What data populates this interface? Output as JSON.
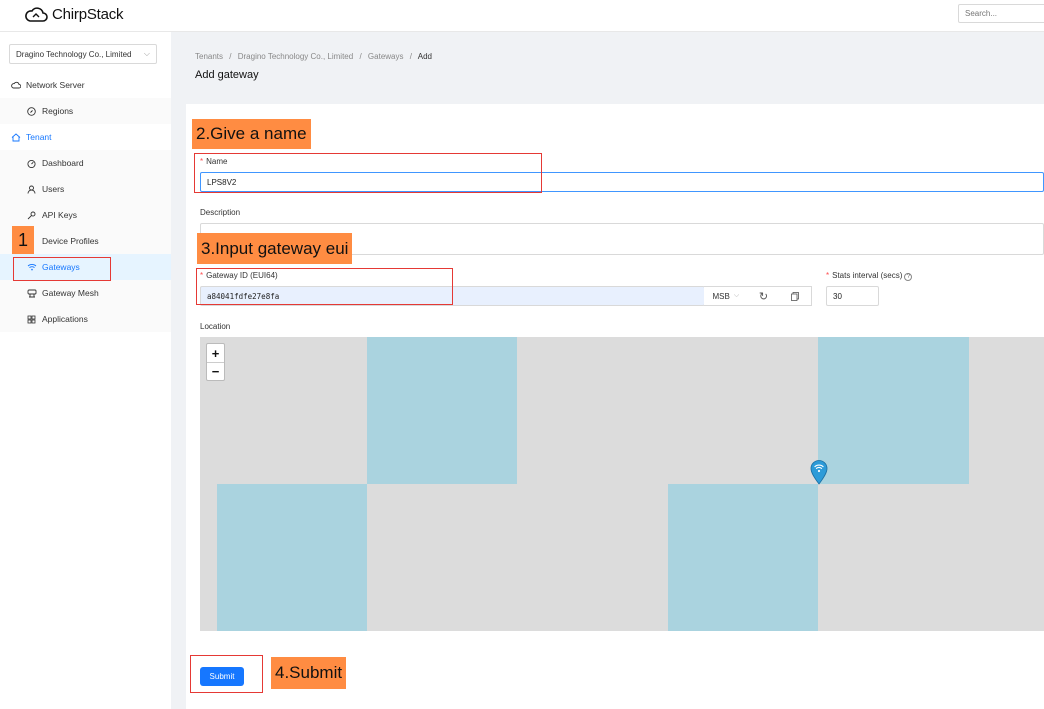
{
  "header": {
    "brand": "ChirpStack",
    "search_placeholder": "Search..."
  },
  "sidebar": {
    "tenant_selected": "Dragino Technology Co., Limited",
    "items": [
      {
        "label": "Network Server",
        "icon": "cloud-icon"
      },
      {
        "label": "Regions",
        "icon": "compass-icon"
      },
      {
        "label": "Tenant",
        "icon": "home-icon"
      },
      {
        "label": "Dashboard",
        "icon": "dashboard-icon"
      },
      {
        "label": "Users",
        "icon": "user-icon"
      },
      {
        "label": "API Keys",
        "icon": "key-icon"
      },
      {
        "label": "Device Profiles",
        "icon": "sliders-icon"
      },
      {
        "label": "Gateways",
        "icon": "wifi-icon"
      },
      {
        "label": "Gateway Mesh",
        "icon": "mesh-icon"
      },
      {
        "label": "Applications",
        "icon": "grid-icon"
      }
    ]
  },
  "breadcrumb": {
    "items": [
      "Tenants",
      "Dragino Technology Co., Limited",
      "Gateways",
      "Add"
    ],
    "separator": "/"
  },
  "page": {
    "title": "Add gateway"
  },
  "form": {
    "name_label": "Name",
    "name_value": "LPS8V2",
    "description_label": "Description",
    "description_value": "",
    "eui_label": "Gateway ID (EUI64)",
    "eui_value": "a84041fdfe27e8fa",
    "eui_byte_order": "MSB",
    "stats_label": "Stats interval (secs)",
    "stats_value": "30",
    "location_label": "Location",
    "submit_label": "Submit"
  },
  "map": {
    "zoom_in": "+",
    "zoom_out": "−"
  },
  "annotations": {
    "step1": "1",
    "step2": "2.Give a name",
    "step3": "3.Input gateway eui",
    "step4": "4.Submit"
  },
  "colors": {
    "accent": "#1677ff",
    "annotation_fill": "#ff8c42",
    "annotation_border": "#e53935",
    "water": "#aad3df",
    "land": "#dcdcdc"
  }
}
